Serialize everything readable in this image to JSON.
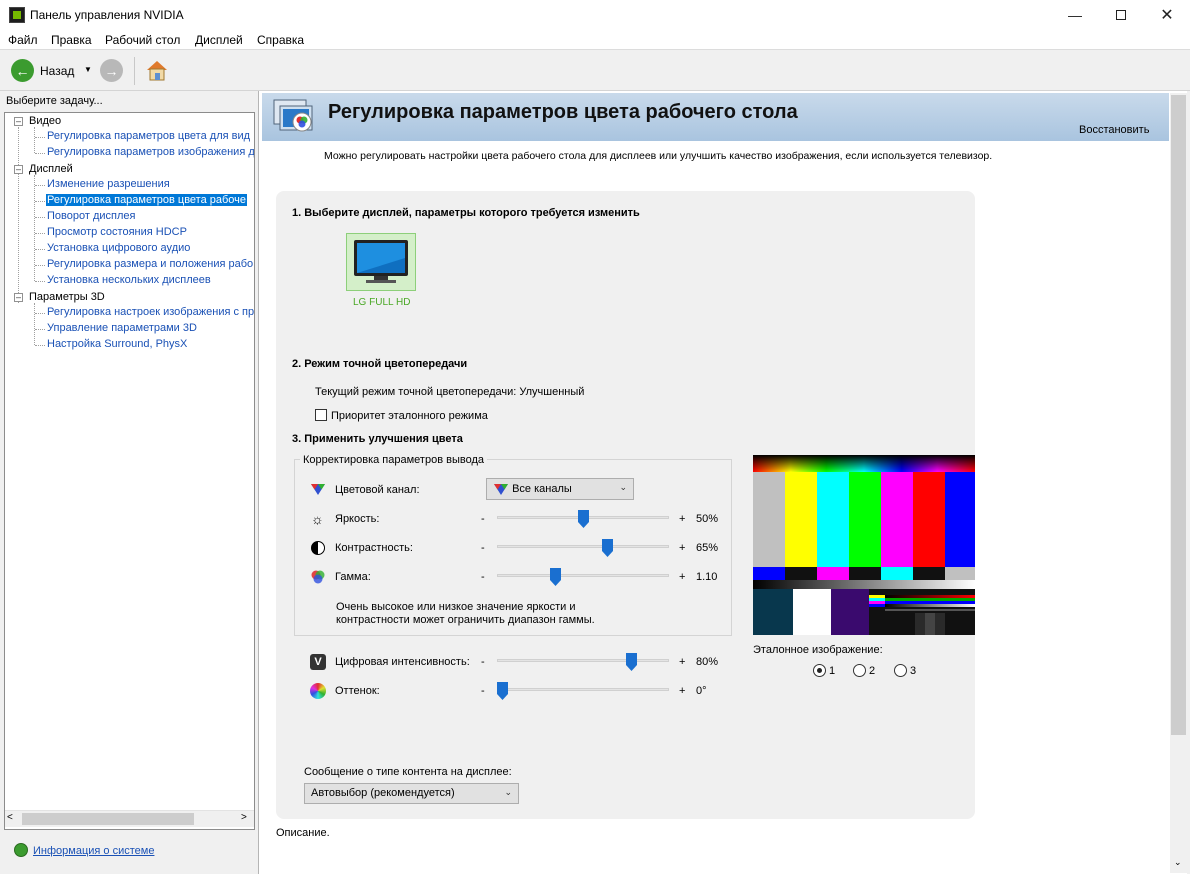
{
  "window": {
    "title": "Панель управления NVIDIA"
  },
  "menu": [
    "Файл",
    "Правка",
    "Рабочий стол",
    "Дисплей",
    "Справка"
  ],
  "toolbar": {
    "back_label": "Назад"
  },
  "sidebar": {
    "task_label": "Выберите задачу...",
    "categories": [
      {
        "label": "Видео",
        "items": [
          "Регулировка параметров цвета для вид",
          "Регулировка параметров изображения д"
        ]
      },
      {
        "label": "Дисплей",
        "items": [
          "Изменение разрешения",
          "Регулировка параметров цвета рабоче",
          "Поворот дисплея",
          "Просмотр состояния HDCP",
          "Установка цифрового аудио",
          "Регулировка размера и положения рабо",
          "Установка нескольких дисплеев"
        ]
      },
      {
        "label": "Параметры 3D",
        "items": [
          "Регулировка настроек изображения с пр",
          "Управление параметрами 3D",
          "Настройка Surround, PhysX"
        ]
      }
    ],
    "selected_item": "Регулировка параметров цвета рабоче",
    "system_info_link": "Информация о системе"
  },
  "main": {
    "title": "Регулировка параметров цвета рабочего стола",
    "restore_label": "Восстановить",
    "description": "Можно регулировать настройки цвета рабочего стола для дисплеев или улучшить качество изображения, если используется телевизор.",
    "step1": {
      "heading": "1. Выберите дисплей, параметры которого требуется изменить",
      "display_name": "LG FULL HD"
    },
    "step2": {
      "heading": "2. Режим точной цветопередачи",
      "current_mode": "Текущий режим точной цветопередачи: Улучшенный",
      "priority_checkbox": "Приоритет эталонного режима",
      "priority_checked": false
    },
    "step3": {
      "heading": "3. Применить улучшения цвета",
      "group_label": "Корректировка параметров вывода",
      "channel_label": "Цветовой канал:",
      "channel_value": "Все каналы",
      "sliders": [
        {
          "label": "Яркость:",
          "minus": "-",
          "plus": "+",
          "value_text": "50%",
          "level": 0.5
        },
        {
          "label": "Контрастность:",
          "minus": "-",
          "plus": "+",
          "value_text": "65%",
          "level": 0.65
        },
        {
          "label": "Гамма:",
          "minus": "-",
          "plus": "+",
          "value_text": "1.10",
          "level": 0.33
        }
      ],
      "warning": [
        "Очень высокое или низкое значение яркости и",
        "контрастности может ограничить диапазон гаммы."
      ],
      "extra_sliders": [
        {
          "label": "Цифровая интенсивность:",
          "minus": "-",
          "plus": "+",
          "value_text": "80%",
          "level": 0.8
        },
        {
          "label": "Оттенок:",
          "minus": "-",
          "plus": "+",
          "value_text": "0°",
          "level": 0.0
        }
      ],
      "reference_label": "Эталонное изображение:",
      "reference_options": [
        "1",
        "2",
        "3"
      ],
      "reference_selected": "1"
    },
    "content_type": {
      "label": "Сообщение о типе контента на дисплее:",
      "value": "Автовыбор (рекомендуется)"
    },
    "description_label": "Описание."
  },
  "colors": {
    "link": "#1a51b5",
    "selected": "#0078d7",
    "slider_thumb": "#1a6fd0",
    "nvidia_green": "#76b900",
    "banner": "#b7cde3"
  }
}
